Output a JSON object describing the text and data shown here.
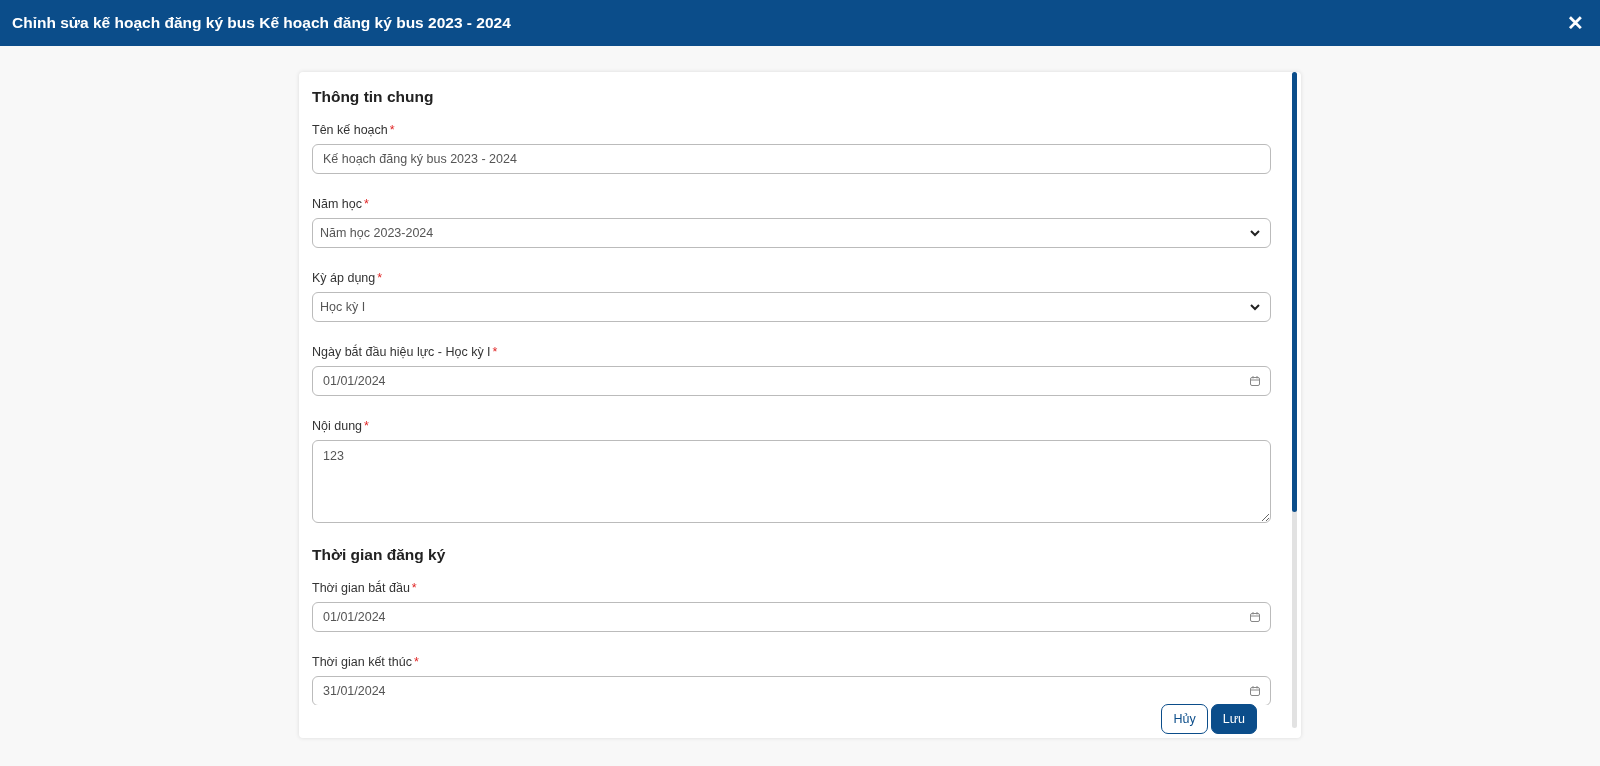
{
  "window": {
    "title": "Chỉnh sửa kế hoạch đăng ký bus Kế hoạch đăng ký bus 2023 - 2024",
    "close": "✕"
  },
  "sections": [
    {
      "title": "Thông tin chung",
      "fields": [
        {
          "kind": "text",
          "label": "Tên kế hoạch",
          "required_mark": "*",
          "value": "Kế hoạch đăng ký bus 2023 - 2024"
        },
        {
          "kind": "select",
          "label": "Năm học",
          "required_mark": "*",
          "value": "Năm học 2023-2024"
        },
        {
          "kind": "select",
          "label": "Kỳ áp dụng",
          "required_mark": "*",
          "value": "Học kỳ I"
        },
        {
          "kind": "date",
          "label": "Ngày bắt đầu hiệu lực - Học kỳ I",
          "required_mark": "*",
          "value": "01/01/2024"
        },
        {
          "kind": "textarea",
          "label": "Nội dung",
          "required_mark": "*",
          "value": "123"
        }
      ]
    },
    {
      "title": "Thời gian đăng ký",
      "fields": [
        {
          "kind": "date",
          "label": "Thời gian bắt đầu",
          "required_mark": "*",
          "value": "01/01/2024"
        },
        {
          "kind": "date",
          "label": "Thời gian kết thúc",
          "required_mark": "*",
          "value": "31/01/2024"
        }
      ]
    }
  ],
  "buttons": [
    {
      "label": "Hủy",
      "kind": "outline"
    },
    {
      "label": "Lưu",
      "kind": "primary"
    }
  ]
}
